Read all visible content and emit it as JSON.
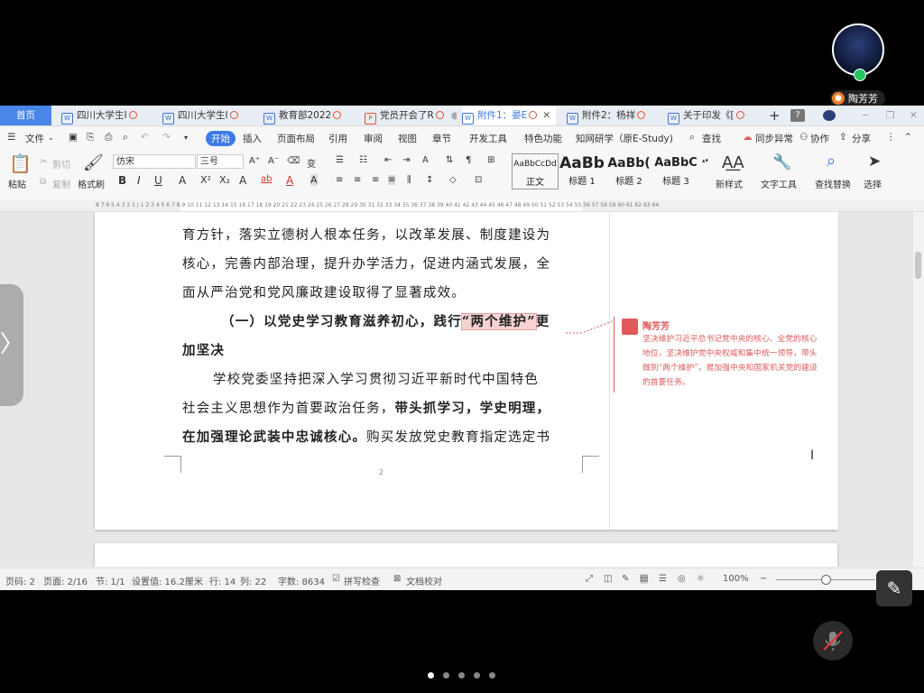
{
  "presenter": {
    "name": "陶芳芳"
  },
  "tabs": {
    "home": "首页",
    "items": [
      {
        "label": "四川大学生I",
        "kind": "w"
      },
      {
        "label": "四川大学生I",
        "kind": "w"
      },
      {
        "label": "教育部2022",
        "kind": "w"
      },
      {
        "label": "党员开会了R",
        "kind": "p"
      },
      {
        "label": "附件1：晏E",
        "kind": "w"
      },
      {
        "label": "附件2：杨祥",
        "kind": "w"
      },
      {
        "label": "关于印发《[",
        "kind": "w"
      }
    ],
    "count": "7",
    "add": "+"
  },
  "menu": {
    "file": "文件",
    "items": [
      "开始",
      "插入",
      "页面布局",
      "引用",
      "审阅",
      "视图",
      "章节",
      "开发工具",
      "特色功能",
      "知网研学（原E-Study)"
    ],
    "find": "查找",
    "sync": "同步异常",
    "collab": "协作",
    "share": "分享"
  },
  "ribbon": {
    "paste": "粘贴",
    "cut": "剪切",
    "copy": "复制",
    "format_painter": "格式刷",
    "font": "仿宋",
    "size": "三号",
    "styles": [
      {
        "preview": "AaBbCcDd",
        "label": "正文"
      },
      {
        "preview": "AaBb",
        "label": "标题 1"
      },
      {
        "preview": "AaBb(",
        "label": "标题 2"
      },
      {
        "preview": "AaBbC",
        "label": "标题 3"
      }
    ],
    "new_style": "新样式",
    "text_tools": "文字工具",
    "find_replace": "查找替换",
    "select": "选择"
  },
  "ruler": "8 7 6 5 4 3 2 1 | 1 2 3 4 5 6 7 8 9 10 11 12 13 14 15 16 17 18 19 20 21 22 23 24 25 26 27 28 29 30 31 32 33 34 35 36 37 38 39 40 41 42 43 44 45 46 47 48 49 50 51 52 53 54 55 56 57 58 59 60 61 62 63 64",
  "doc": {
    "line1": "育方针，落实立德树人根本任务，以改革发展、制度建设为",
    "line2": "核心，完善内部治理，提升办学活力，促进内涵式发展，全",
    "line3": "面从严治党和党风廉政建设取得了显著成效。",
    "heading_a": "（一）以党史学习教育滋养初心，践行",
    "heading_hl": "“两个维护”",
    "heading_b": "更",
    "heading_c": "加坚决",
    "p1": "学校党委坚持把深入学习贯彻习近平新时代中国特色",
    "p2a": "社会主义思想作为首要政治任务，",
    "p2b": "带头抓学习，学史明理，",
    "p3a": "在加强理论武装中忠诚核心。",
    "p3b": "购买发放党史教育指定选定书",
    "page_number": "2"
  },
  "comment": {
    "author": "陶芳芳",
    "text": "坚决维护习近平总书记党中央的核心、全党的核心\n地位，坚决维护党中央权威和集中统一领导，带头\n做到“两个维护”，是加强中央和国家机关党的建设\n的首要任务。"
  },
  "status": {
    "page_code": "页码: 2",
    "pages": "页面: 2/16",
    "section": "节: 1/1",
    "setting": "设置值: 16.2厘米",
    "row": "行: 14",
    "col": "列: 22",
    "words": "字数: 8634",
    "spellcheck": "拼写检查",
    "proofread": "文档校对",
    "zoom": "100%"
  }
}
